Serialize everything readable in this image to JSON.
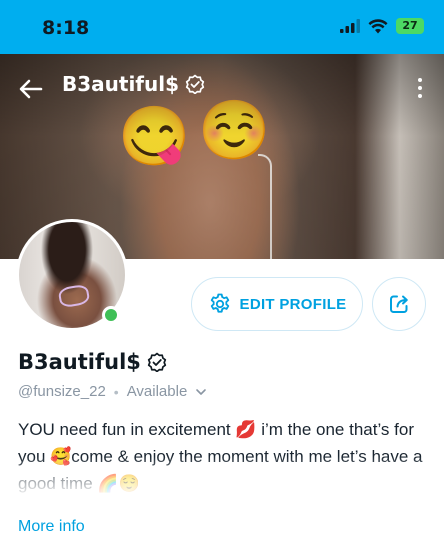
{
  "status_bar": {
    "time": "8:18",
    "battery": "27",
    "accent": "#00aeef"
  },
  "header": {
    "display_name": "B3autiful$",
    "back_icon": "arrow-left-icon",
    "verified_icon": "verified-badge-icon",
    "more_icon": "vertical-dots-icon"
  },
  "cover": {
    "emoji_left": "😋",
    "emoji_right": "☺️"
  },
  "actions": {
    "edit_profile_label": "EDIT PROFILE",
    "edit_icon": "gear-icon",
    "share_icon": "share-icon"
  },
  "profile": {
    "name": "B3autiful$",
    "username": "@funsize_22",
    "availability": "Available",
    "online": true,
    "online_color": "#40c057"
  },
  "bio": {
    "text": "YOU need fun in excitement 💋 i’m the one that’s for you 🥰come & enjoy the moment with me let’s have a good time 🌈😌"
  },
  "more_info_label": "More info"
}
